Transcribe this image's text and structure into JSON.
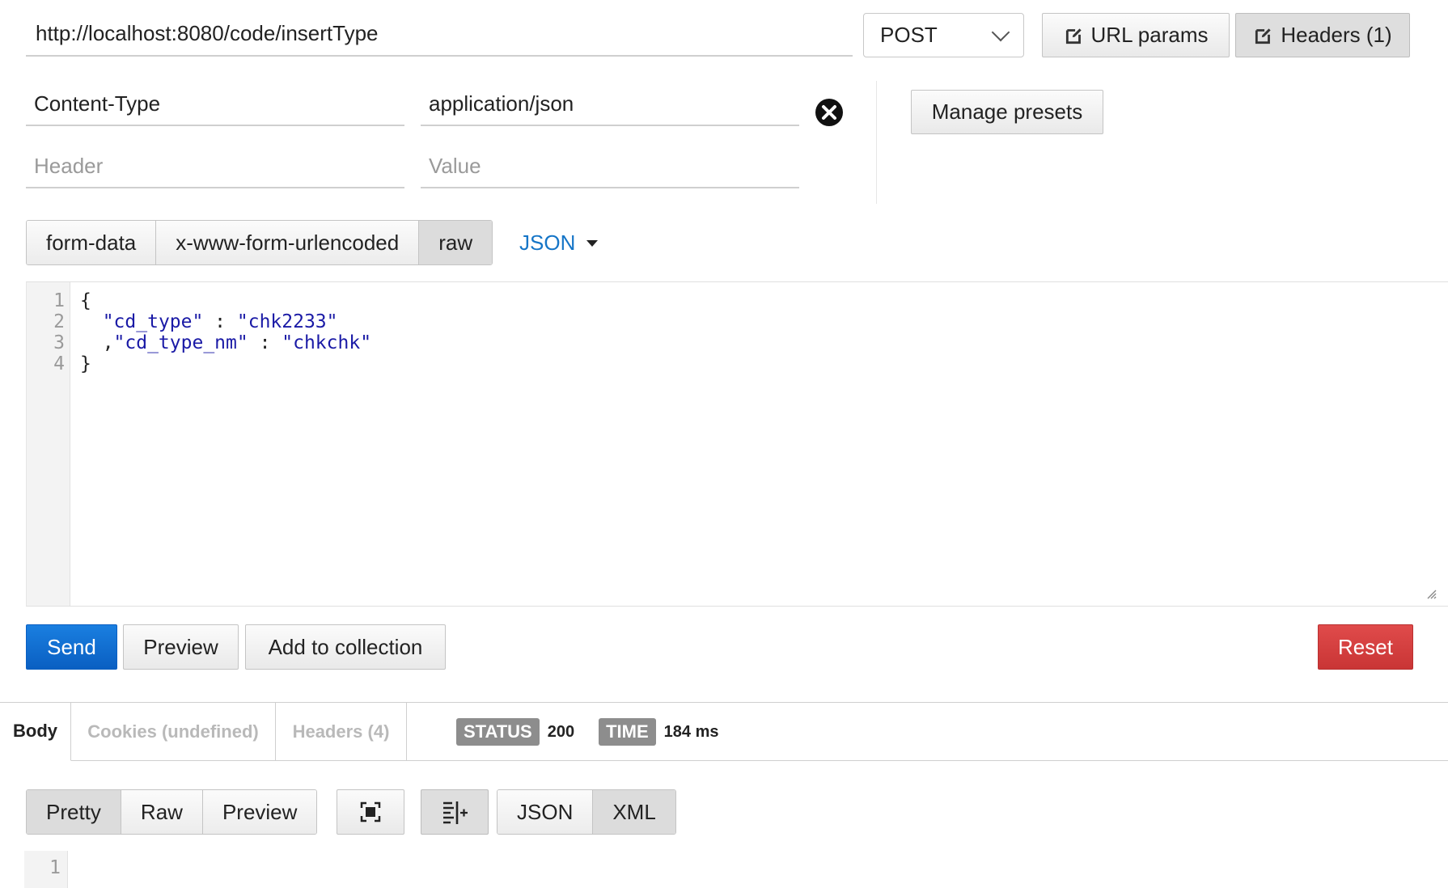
{
  "request": {
    "url": "http://localhost:8080/code/insertType",
    "method": "POST",
    "url_params_label": "URL params",
    "headers_label": "Headers (1)"
  },
  "headers": {
    "rows": [
      {
        "key": "Content-Type",
        "value": "application/json"
      }
    ],
    "key_placeholder": "Header",
    "value_placeholder": "Value",
    "manage_presets_label": "Manage presets"
  },
  "body_types": {
    "items": [
      "form-data",
      "x-www-form-urlencoded",
      "raw"
    ],
    "selected": "raw",
    "format_label": "JSON"
  },
  "editor": {
    "line_numbers": [
      "1",
      "2",
      "3",
      "4"
    ],
    "lines": [
      {
        "prefix": "{",
        "str1": "",
        "mid": "",
        "str2": ""
      },
      {
        "prefix": "  ",
        "str1": "\"cd_type\"",
        "mid": " : ",
        "str2": "\"chk2233\""
      },
      {
        "prefix": "  ,",
        "str1": "\"cd_type_nm\"",
        "mid": " : ",
        "str2": "\"chkchk\""
      },
      {
        "prefix": "}",
        "str1": "",
        "mid": "",
        "str2": ""
      }
    ]
  },
  "actions": {
    "send_label": "Send",
    "preview_label": "Preview",
    "add_collection_label": "Add to collection",
    "reset_label": "Reset"
  },
  "response": {
    "tabs": [
      "Body",
      "Cookies (undefined)",
      "Headers (4)"
    ],
    "status_label": "STATUS",
    "status_value": "200",
    "time_label": "TIME",
    "time_value": "184 ms",
    "view_modes": [
      "Pretty",
      "Raw",
      "Preview"
    ],
    "formats": [
      "JSON",
      "XML"
    ],
    "line_numbers": [
      "1"
    ]
  },
  "colors": {
    "send": "#0a5fc2",
    "reset": "#c93535",
    "link": "#1575c7",
    "json_string": "#1a1aa6"
  }
}
